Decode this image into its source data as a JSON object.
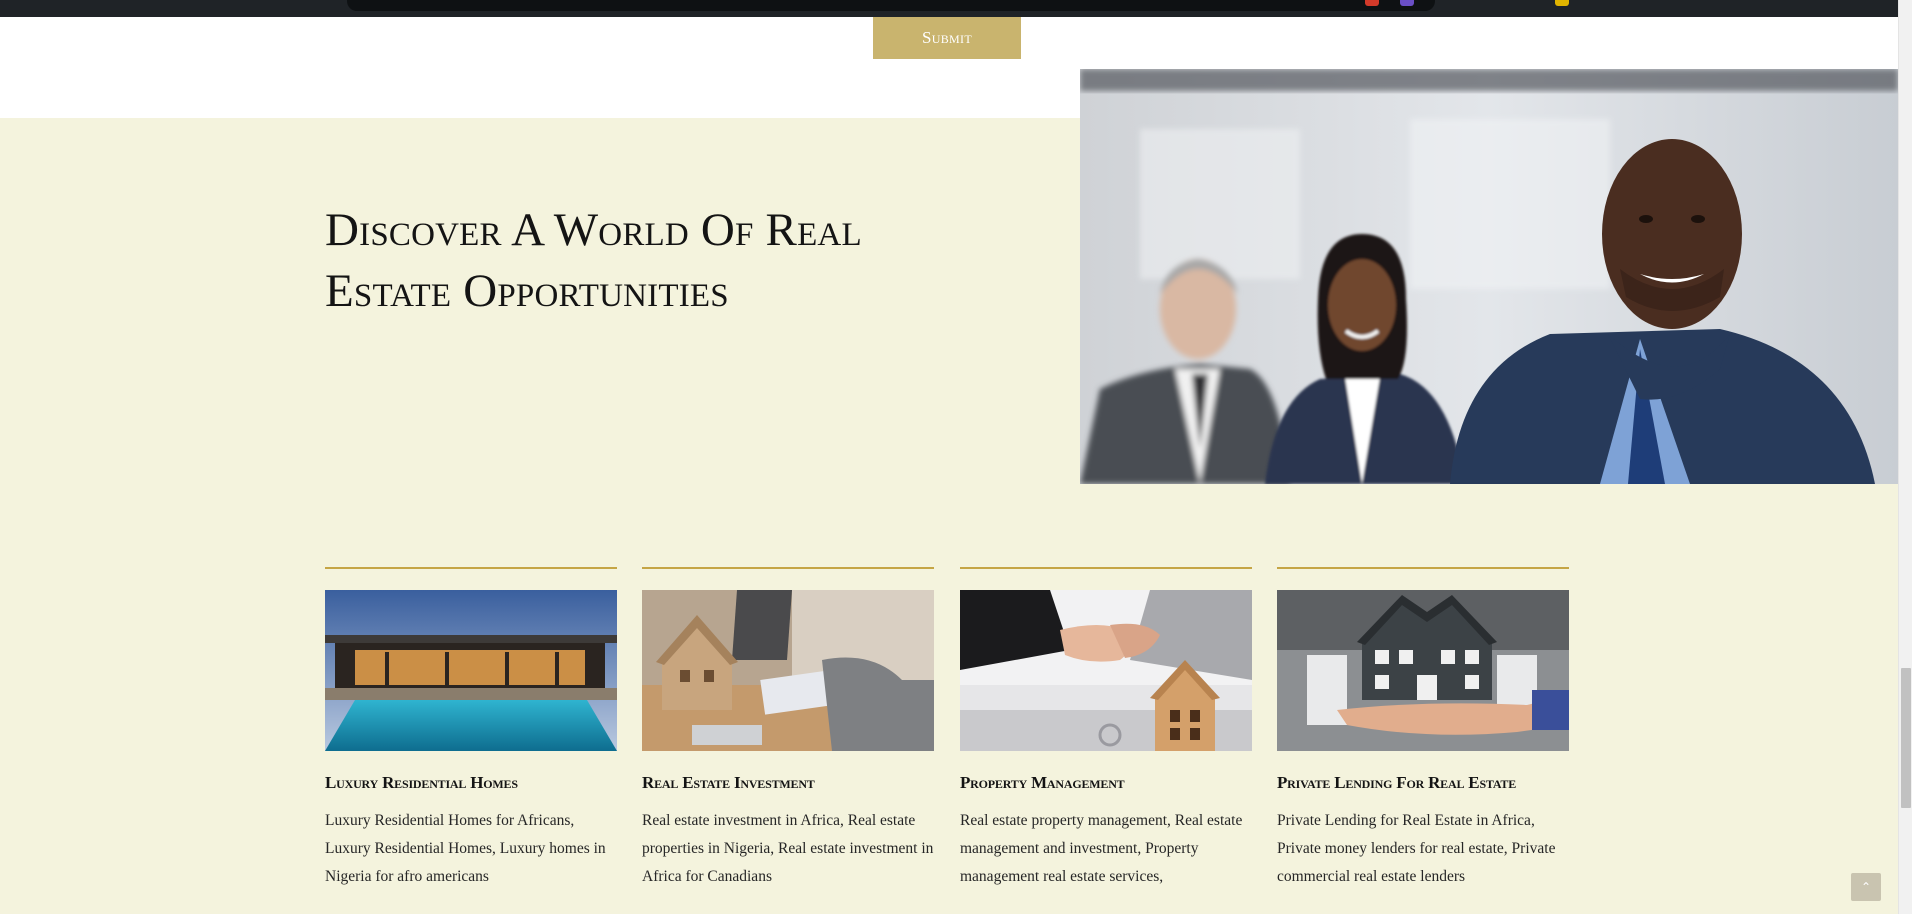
{
  "form": {
    "submit_label": "Submit"
  },
  "discover": {
    "title": "Discover A World Of Real Estate Opportunities",
    "hero_image": "three-smiling-business-professionals"
  },
  "cards": [
    {
      "title": "Luxury Residential Homes",
      "description": "Luxury Residential Homes for Africans, Luxury Residential Homes, Luxury homes in Nigeria for afro americans",
      "image": "luxury-home-pool-dusk"
    },
    {
      "title": "Real Estate Investment",
      "description": "Real estate investment in Africa, Real estate properties in Nigeria, Real estate investment in Africa for Canadians",
      "image": "house-model-on-desk-meeting"
    },
    {
      "title": "Property Management",
      "description": "Real estate property management, Real estate management and investment, Property management real estate services,",
      "image": "handshake-wooden-house"
    },
    {
      "title": "Private Lending For Real Estate",
      "description": "Private Lending for Real Estate in Africa, Private money lenders for real estate, Private commercial real estate lenders",
      "image": "hand-holding-house-model"
    }
  ],
  "icons": {
    "back_to_top": "chevron-up-icon"
  },
  "colors": {
    "accent": "#c9b46e",
    "rule": "#c5a545",
    "section_bg": "#f4f3dd",
    "topbar": "#1f2327"
  }
}
